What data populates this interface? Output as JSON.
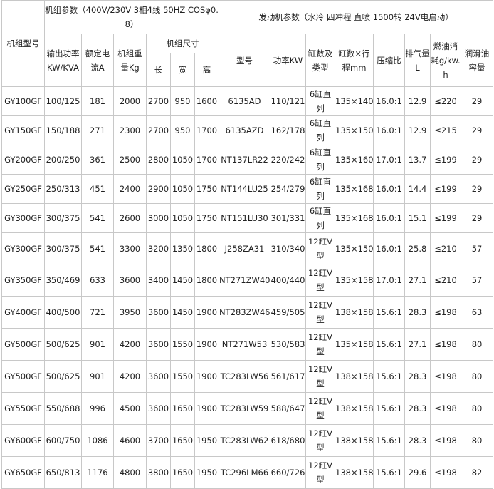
{
  "header": {
    "model": "机组型号",
    "genset_group": "机组参数（400V/230V 3相4线 50HZ COSφ0.8）",
    "engine_group": "发动机参数（水冷 四冲程 直喷 1500转 24V电启动）",
    "output_power": "输出功率KW/KVA",
    "rated_current": "额定电流A",
    "weight": "机组重量Kg",
    "dimensions": "机组尺寸",
    "length": "长",
    "width": "宽",
    "height": "高",
    "engine_model": "型号",
    "engine_power": "功率KW",
    "cylinder_type": "缸数及类型",
    "bore_stroke": "缸数×行程mm",
    "compression": "压缩比",
    "displacement": "排气量L",
    "fuel": "燃油消耗g/kw.h",
    "lube": "润滑油容量"
  },
  "rows": [
    {
      "model": "GY100GF",
      "power": "100/125",
      "current": "181",
      "weight": "2000",
      "l": "2700",
      "w": "950",
      "h": "1600",
      "engine": "6135AD",
      "epower": "110/121",
      "cyl": "6缸直列",
      "bore": "135×140",
      "ratio": "16.0:1",
      "disp": "12.9",
      "fuel": "≤220",
      "lube": "29"
    },
    {
      "model": "GY150GF",
      "power": "150/188",
      "current": "271",
      "weight": "2300",
      "l": "2700",
      "w": "950",
      "h": "1700",
      "engine": "6135AZD",
      "epower": "162/178",
      "cyl": "6缸直列",
      "bore": "135×150",
      "ratio": "16.0:1",
      "disp": "12.9",
      "fuel": "≤215",
      "lube": "29"
    },
    {
      "model": "GY200GF",
      "power": "200/250",
      "current": "361",
      "weight": "2500",
      "l": "2800",
      "w": "1050",
      "h": "1700",
      "engine": "NT137LR22",
      "epower": "220/242",
      "cyl": "6缸直列",
      "bore": "135×160",
      "ratio": "17.0:1",
      "disp": "13.7",
      "fuel": "≤199",
      "lube": "29"
    },
    {
      "model": "GY250GF",
      "power": "250/313",
      "current": "451",
      "weight": "2400",
      "l": "2900",
      "w": "1050",
      "h": "1750",
      "engine": "NT144LU25",
      "epower": "254/279",
      "cyl": "6缸直列",
      "bore": "135×168",
      "ratio": "16.0:1",
      "disp": "14.4",
      "fuel": "≤199",
      "lube": "29"
    },
    {
      "model": "GY300GF",
      "power": "300/375",
      "current": "541",
      "weight": "2600",
      "l": "3000",
      "w": "1050",
      "h": "1750",
      "engine": "NT151LU30",
      "epower": "301/331",
      "cyl": "6缸直列",
      "bore": "135×168",
      "ratio": "16.0:1",
      "disp": "15.1",
      "fuel": "≤199",
      "lube": "29"
    },
    {
      "model": "GY300GF",
      "power": "300/375",
      "current": "541",
      "weight": "3300",
      "l": "3200",
      "w": "1350",
      "h": "1800",
      "engine": "J258ZA31",
      "epower": "310/340",
      "cyl": "12缸V型",
      "bore": "135×150",
      "ratio": "16.0:1",
      "disp": "25.8",
      "fuel": "≤210",
      "lube": "57"
    },
    {
      "model": "GY350GF",
      "power": "350/469",
      "current": "633",
      "weight": "3600",
      "l": "3400",
      "w": "1450",
      "h": "1800",
      "engine": "NT271ZW40",
      "epower": "400/440",
      "cyl": "12缸V型",
      "bore": "135×158",
      "ratio": "17.0:1",
      "disp": "27.1",
      "fuel": "≤210",
      "lube": "57"
    },
    {
      "model": "GY400GF",
      "power": "400/500",
      "current": "721",
      "weight": "3950",
      "l": "3600",
      "w": "1450",
      "h": "1900",
      "engine": "NT283ZW46",
      "epower": "459/505",
      "cyl": "12缸V型",
      "bore": "138×158",
      "ratio": "15.6:1",
      "disp": "28.3",
      "fuel": "≤198",
      "lube": "63"
    },
    {
      "model": "GY500GF",
      "power": "500/625",
      "current": "901",
      "weight": "4200",
      "l": "3600",
      "w": "1550",
      "h": "1900",
      "engine": "NT271W53",
      "epower": "530/583",
      "cyl": "12缸V型",
      "bore": "135×158",
      "ratio": "15.6:1",
      "disp": "27.1",
      "fuel": "≤198",
      "lube": "80"
    },
    {
      "model": "GY500GF",
      "power": "500/625",
      "current": "901",
      "weight": "4200",
      "l": "3600",
      "w": "1550",
      "h": "1900",
      "engine": "TC283LW56",
      "epower": "561/617",
      "cyl": "12缸V型",
      "bore": "138×158",
      "ratio": "15.6:1",
      "disp": "28.3",
      "fuel": "≤198",
      "lube": "80"
    },
    {
      "model": "GY550GF",
      "power": "550/688",
      "current": "996",
      "weight": "4500",
      "l": "3600",
      "w": "1650",
      "h": "1900",
      "engine": "TC283LW59",
      "epower": "588/647",
      "cyl": "12缸V型",
      "bore": "138×158",
      "ratio": "15.6:1",
      "disp": "28.3",
      "fuel": "≤198",
      "lube": "80"
    },
    {
      "model": "GY600GF",
      "power": "600/750",
      "current": "1086",
      "weight": "4600",
      "l": "3700",
      "w": "1650",
      "h": "1950",
      "engine": "TC283LW62",
      "epower": "618/680",
      "cyl": "12缸V型",
      "bore": "138×158",
      "ratio": "15.6:1",
      "disp": "28.3",
      "fuel": "≤198",
      "lube": "80"
    },
    {
      "model": "GY650GF",
      "power": "650/813",
      "current": "1176",
      "weight": "4800",
      "l": "3800",
      "w": "1650",
      "h": "1950",
      "engine": "TC296LM66",
      "epower": "660/726",
      "cyl": "12缸V型",
      "bore": "138×158",
      "ratio": "15.6:1",
      "disp": "29.6",
      "fuel": "≤198",
      "lube": "82"
    }
  ]
}
